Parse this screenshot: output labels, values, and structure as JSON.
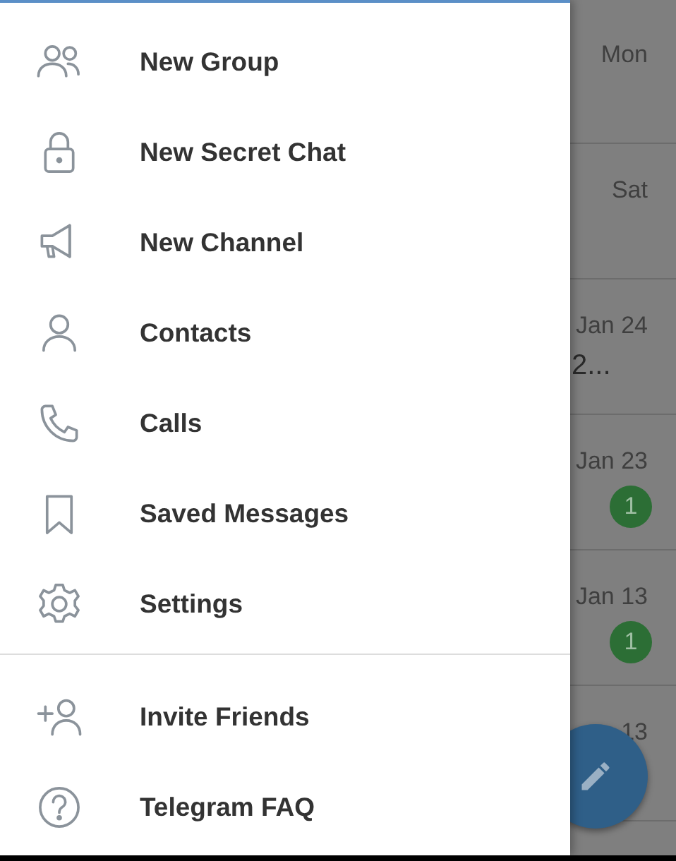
{
  "drawer": {
    "items": [
      {
        "kind": "group",
        "label": "New Group"
      },
      {
        "kind": "lock",
        "label": "New Secret Chat"
      },
      {
        "kind": "megaphone",
        "label": "New Channel"
      },
      {
        "kind": "person",
        "label": "Contacts"
      },
      {
        "kind": "phone",
        "label": "Calls"
      },
      {
        "kind": "bookmark",
        "label": "Saved Messages"
      },
      {
        "kind": "gear",
        "label": "Settings"
      }
    ],
    "footer_items": [
      {
        "kind": "add-person",
        "label": "Invite Friends"
      },
      {
        "kind": "help",
        "label": "Telegram FAQ"
      }
    ]
  },
  "chat_list": [
    {
      "date": "Mon"
    },
    {
      "date": "Sat"
    },
    {
      "date": "Jan 24",
      "preview": "2..."
    },
    {
      "date": "Jan 23",
      "badge": "1"
    },
    {
      "date": "Jan 13",
      "badge": "1"
    },
    {
      "date": "13"
    }
  ]
}
